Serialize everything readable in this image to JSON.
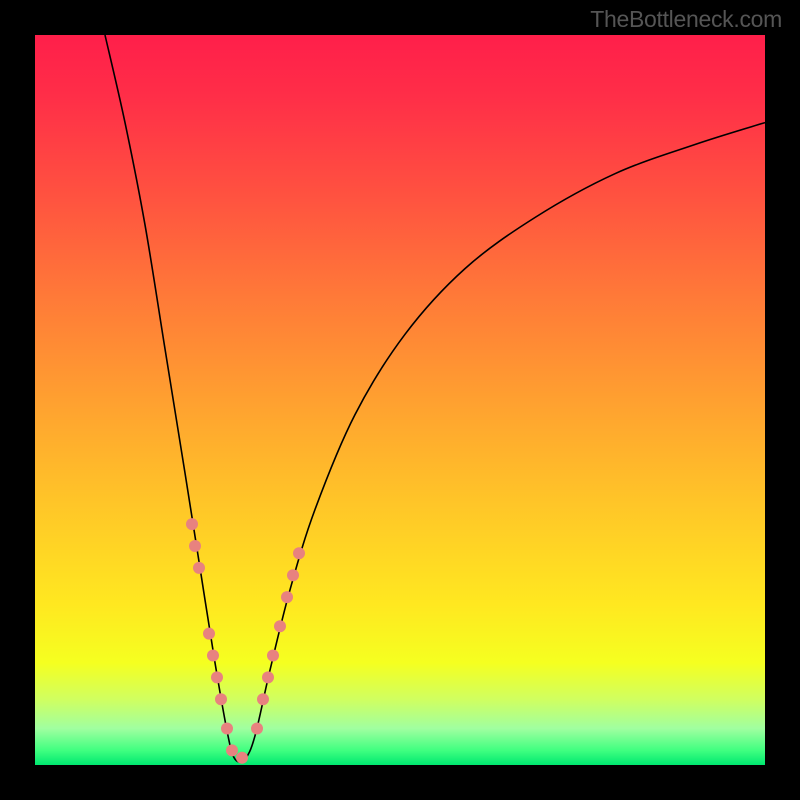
{
  "watermark": "TheBottleneck.com",
  "chart_data": {
    "type": "line",
    "title": "",
    "xlabel": "",
    "ylabel": "",
    "x_range": [
      0,
      730
    ],
    "y_range_note": "y is bottleneck percent; 0 at bottom (green), ~100 at top (red)",
    "minimum_x": 205,
    "curve_description": "V-shaped bottleneck curve; steep descent from left, sharp minimum near x=205, asymptotic rise toward right",
    "curve_points": [
      {
        "x": 70,
        "y": 100
      },
      {
        "x": 90,
        "y": 88
      },
      {
        "x": 110,
        "y": 74
      },
      {
        "x": 130,
        "y": 57
      },
      {
        "x": 150,
        "y": 40
      },
      {
        "x": 165,
        "y": 27
      },
      {
        "x": 180,
        "y": 14
      },
      {
        "x": 193,
        "y": 4
      },
      {
        "x": 200,
        "y": 0.8
      },
      {
        "x": 210,
        "y": 0.8
      },
      {
        "x": 220,
        "y": 4
      },
      {
        "x": 235,
        "y": 13
      },
      {
        "x": 255,
        "y": 24
      },
      {
        "x": 280,
        "y": 35
      },
      {
        "x": 320,
        "y": 48
      },
      {
        "x": 370,
        "y": 59
      },
      {
        "x": 430,
        "y": 68
      },
      {
        "x": 500,
        "y": 75
      },
      {
        "x": 580,
        "y": 81
      },
      {
        "x": 660,
        "y": 85
      },
      {
        "x": 730,
        "y": 88
      }
    ],
    "markers": [
      {
        "x": 157,
        "y": 33
      },
      {
        "x": 160,
        "y": 30
      },
      {
        "x": 164,
        "y": 27
      },
      {
        "x": 174,
        "y": 18
      },
      {
        "x": 178,
        "y": 15
      },
      {
        "x": 182,
        "y": 12
      },
      {
        "x": 186,
        "y": 9
      },
      {
        "x": 192,
        "y": 5
      },
      {
        "x": 197,
        "y": 2
      },
      {
        "x": 207,
        "y": 1
      },
      {
        "x": 222,
        "y": 5
      },
      {
        "x": 228,
        "y": 9
      },
      {
        "x": 233,
        "y": 12
      },
      {
        "x": 238,
        "y": 15
      },
      {
        "x": 245,
        "y": 19
      },
      {
        "x": 252,
        "y": 23
      },
      {
        "x": 258,
        "y": 26
      },
      {
        "x": 264,
        "y": 29
      }
    ],
    "marker_radius": 6
  }
}
